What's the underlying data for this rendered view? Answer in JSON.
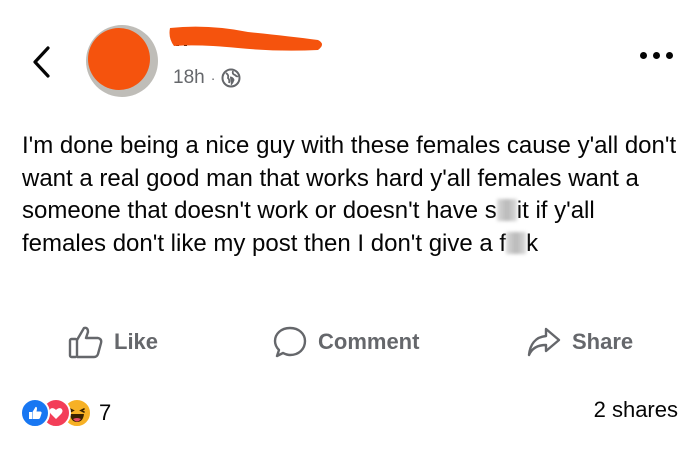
{
  "post": {
    "timestamp": "18h",
    "separator": "·",
    "privacy_icon": "globe-icon",
    "text_before_blur_1": "I'm done being a nice guy with these females cause y'all don't want a real good man that works hard y'all females want a someone that doesn't work or doesn't have s",
    "text_between_blurs": "it if y'all females don't like my post then I don't give a f",
    "text_after_blur_2": "k"
  },
  "actions": {
    "like_label": "Like",
    "comment_label": "Comment",
    "share_label": "Share"
  },
  "footer": {
    "reaction_icons": [
      "like-icon",
      "love-icon",
      "haha-icon"
    ],
    "reaction_count": "7",
    "shares_text": "2 shares"
  },
  "colors": {
    "redaction": "#f5530d",
    "muted_text": "#65676b",
    "like_blue": "#1877f2",
    "love_red": "#f33e58",
    "haha_yellow": "#f7b125"
  }
}
